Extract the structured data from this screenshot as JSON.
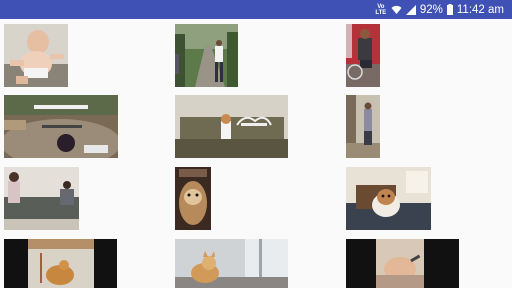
{
  "status_bar": {
    "network_label": "Vo LTE",
    "battery_percent": "92%",
    "time": "11:42 am",
    "icons": [
      "volte-icon",
      "wifi-icon",
      "signal-icon",
      "battery-icon"
    ],
    "color": "#3f51b5"
  },
  "gallery": {
    "background": "#fafafa",
    "items": [
      {
        "subject": "baby",
        "icon": "video-thumbnail"
      },
      {
        "subject": "person-walking-path",
        "icon": "video-thumbnail"
      },
      {
        "subject": "person-with-bike",
        "icon": "video-thumbnail"
      },
      {
        "subject": "skatepark-fisheye",
        "icon": "video-thumbnail"
      },
      {
        "subject": "dog-on-couch-skeleton",
        "icon": "video-thumbnail"
      },
      {
        "subject": "person-in-doorway",
        "icon": "video-thumbnail"
      },
      {
        "subject": "people-on-couch",
        "icon": "video-thumbnail"
      },
      {
        "subject": "dog-closeup",
        "icon": "video-thumbnail"
      },
      {
        "subject": "beagle-on-couch",
        "icon": "video-thumbnail"
      },
      {
        "subject": "cat-on-cabinet",
        "icon": "video-thumbnail"
      },
      {
        "subject": "cat-by-window",
        "icon": "video-thumbnail"
      },
      {
        "subject": "hand-feeding",
        "icon": "video-thumbnail"
      }
    ]
  }
}
